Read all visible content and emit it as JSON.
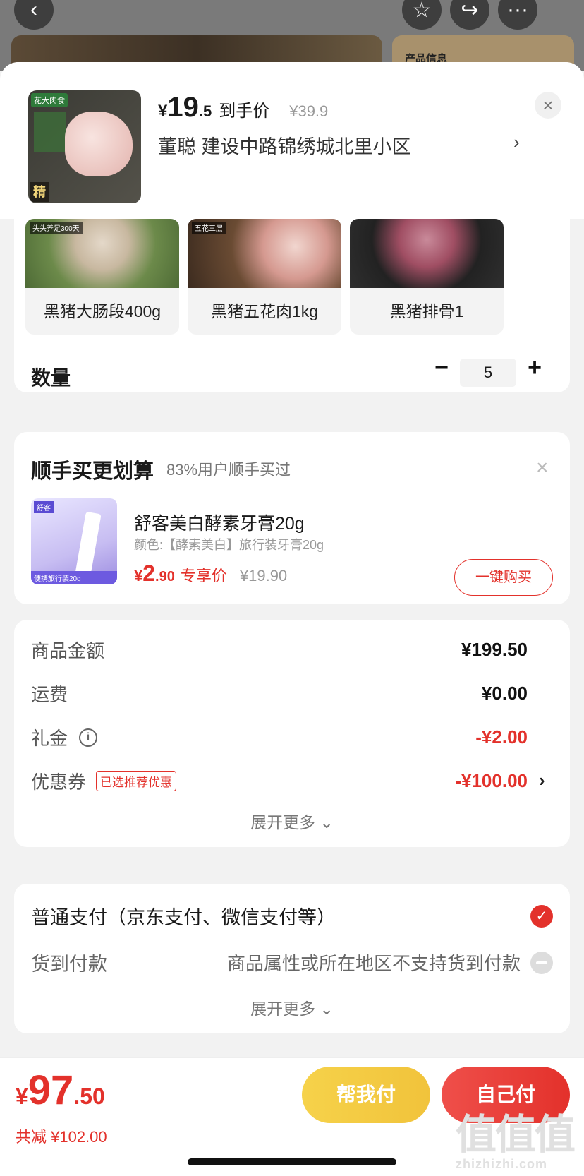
{
  "background": {
    "card_title": "产品信息"
  },
  "header": {
    "price_yen": "¥",
    "price_int": "19",
    "price_dec": ".5",
    "price_label": "到手价",
    "orig_price": "¥39.9",
    "address": "董聪  建设中路锦绣城北里小区",
    "thumb_brand": "花大肉食",
    "thumb_seal": "精"
  },
  "variants": [
    {
      "name": "黑猪大肠段400g",
      "tag": "头头养足300天"
    },
    {
      "name": "黑猪五花肉1kg",
      "tag": "五花三层"
    },
    {
      "name": "黑猪排骨1",
      "tag": ""
    }
  ],
  "quantity": {
    "label": "数量",
    "value": "5"
  },
  "upsell": {
    "title": "顺手买更划算",
    "subtitle": "83%用户顺手买过",
    "product_name": "舒客美白酵素牙膏20g",
    "spec": "颜色:【酵素美白】旅行装牙膏20g",
    "price_yen": "¥",
    "price_int": "2",
    "price_dec": ".90",
    "price_label": "专享价",
    "orig_price": "¥19.90",
    "buy_label": "一键购买",
    "img_top": "舒客",
    "img_bottom": "便携旅行装20g"
  },
  "summary": {
    "rows": [
      {
        "label": "商品金额",
        "value": "¥199.50"
      },
      {
        "label": "运费",
        "value": "¥0.00"
      },
      {
        "label": "礼金",
        "value": "-¥2.00"
      },
      {
        "label": "优惠券",
        "value": "-¥100.00",
        "tag": "已选推荐优惠"
      }
    ],
    "expand": "展开更多 ⌄"
  },
  "payment": {
    "normal": "普通支付（京东支付、微信支付等）",
    "cod": "货到付款",
    "cod_note": "商品属性或所在地区不支持货到付款",
    "expand": "展开更多 ⌄"
  },
  "bottom": {
    "total_yen": "¥",
    "total_int": "97",
    "total_dec": ".50",
    "saved": "共减 ¥102.00",
    "help_pay": "帮我付",
    "self_pay": "自己付"
  },
  "watermark": {
    "big": "值值值",
    "small": "zhizhizhi.com"
  },
  "colors": {
    "accent": "#e3312b",
    "help_btn": "#f1c33b"
  }
}
